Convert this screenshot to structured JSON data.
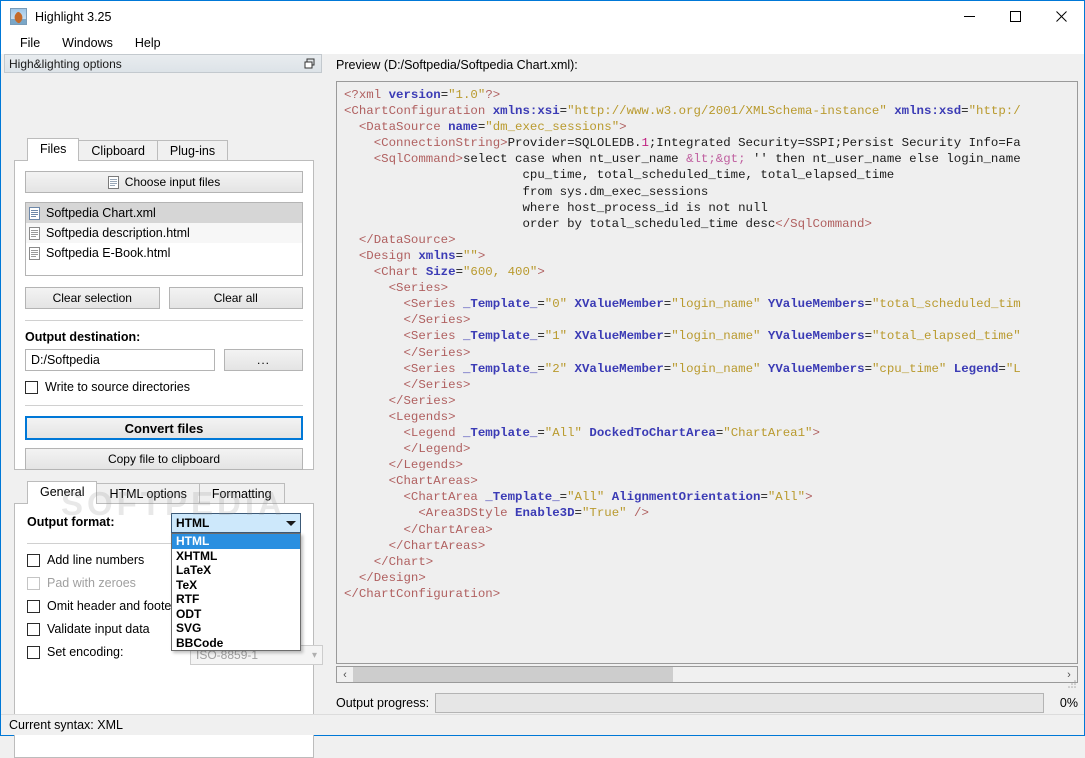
{
  "window": {
    "title": "Highlight 3.25",
    "icon": "app-icon",
    "minimize": "—",
    "maximize": "□",
    "close": "✕"
  },
  "menu": {
    "items": [
      "File",
      "Windows",
      "Help"
    ]
  },
  "dock": {
    "title": "High&lighting options",
    "undock_icon": "undock-icon"
  },
  "files_panel": {
    "tabs": [
      {
        "label": "Files",
        "active": true
      },
      {
        "label": "Clipboard",
        "active": false
      },
      {
        "label": "Plug-ins",
        "active": false
      }
    ],
    "choose_input_files": "Choose input files",
    "file_list": [
      {
        "name": "Softpedia Chart.xml",
        "selected": true
      },
      {
        "name": "Softpedia description.html",
        "selected": false
      },
      {
        "name": "Softpedia E-Book.html",
        "selected": false
      }
    ],
    "clear_selection": "Clear selection",
    "clear_all": "Clear all",
    "output_destination_label": "Output destination:",
    "output_destination_value": "D:/Softpedia",
    "browse_button": "...",
    "write_to_source_label": "Write to source directories",
    "write_to_source_checked": false,
    "convert_files": "Convert files",
    "copy_to_clipboard": "Copy file to clipboard"
  },
  "options_panel": {
    "tabs": [
      {
        "label": "General",
        "active": true
      },
      {
        "label": "HTML options",
        "active": false
      },
      {
        "label": "Formatting",
        "active": false
      }
    ],
    "output_format_label": "Output format:",
    "output_format_value": "HTML",
    "output_format_options": [
      "HTML",
      "XHTML",
      "LaTeX",
      "TeX",
      "RTF",
      "ODT",
      "SVG",
      "BBCode"
    ],
    "output_format_selected_index": 0,
    "checkboxes": [
      {
        "label": "Add line numbers",
        "checked": false,
        "disabled": false
      },
      {
        "label": "Pad with zeroes",
        "checked": false,
        "disabled": true
      },
      {
        "label": "Omit header and footer",
        "checked": false,
        "disabled": false
      },
      {
        "label": "Validate input data",
        "checked": false,
        "disabled": false
      },
      {
        "label": "Set encoding:",
        "checked": false,
        "disabled": false
      }
    ],
    "encoding_value": "ISO-8859-1"
  },
  "watermark": "SOFTPEDIA",
  "preview": {
    "label": "Preview (D:/Softpedia/Softpedia Chart.xml):",
    "hscroll": {
      "left_arrow": "‹",
      "right_arrow": "›"
    }
  },
  "progress": {
    "label": "Output progress:",
    "percent": "0%",
    "value": 0
  },
  "status": {
    "text": "Current syntax: XML"
  },
  "colors": {
    "accent": "#0078d7",
    "tag": "#b06060",
    "attr_name": "#7b7bc0",
    "attr_value": "#b99a2e",
    "element_name": "#3b3bb5",
    "entity": "#c060a0",
    "number": "#c02080",
    "selection": "#2a8fe0"
  },
  "code_lines": [
    [
      {
        "t": "pi",
        "v": "<?xml "
      },
      {
        "t": "name",
        "v": "version"
      },
      {
        "t": "txt",
        "v": "="
      },
      {
        "t": "str",
        "v": "\"1.0\""
      },
      {
        "t": "pi",
        "v": "?>"
      }
    ],
    [
      {
        "t": "tag",
        "v": "<ChartConfiguration "
      },
      {
        "t": "name",
        "v": "xmlns:xsi"
      },
      {
        "t": "txt",
        "v": "="
      },
      {
        "t": "str",
        "v": "\"http://www.w3.org/2001/XMLSchema-instance\""
      },
      {
        "t": "txt",
        "v": " "
      },
      {
        "t": "name",
        "v": "xmlns:xsd"
      },
      {
        "t": "txt",
        "v": "="
      },
      {
        "t": "str",
        "v": "\"http:/"
      }
    ],
    [
      {
        "t": "txt",
        "v": "  "
      },
      {
        "t": "tag",
        "v": "<DataSource "
      },
      {
        "t": "name",
        "v": "name"
      },
      {
        "t": "txt",
        "v": "="
      },
      {
        "t": "str",
        "v": "\"dm_exec_sessions\""
      },
      {
        "t": "tag",
        "v": ">"
      }
    ],
    [
      {
        "t": "txt",
        "v": "    "
      },
      {
        "t": "tag",
        "v": "<ConnectionString>"
      },
      {
        "t": "txt",
        "v": "Provider=SQLOLEDB."
      },
      {
        "t": "num",
        "v": "1"
      },
      {
        "t": "txt",
        "v": ";Integrated Security=SSPI;Persist Security Info=Fa"
      }
    ],
    [
      {
        "t": "txt",
        "v": "    "
      },
      {
        "t": "tag",
        "v": "<SqlCommand>"
      },
      {
        "t": "txt",
        "v": "select case when nt_user_name "
      },
      {
        "t": "ent",
        "v": "&lt;&gt;"
      },
      {
        "t": "txt",
        "v": " '' then nt_user_name else login_name"
      }
    ],
    [
      {
        "t": "txt",
        "v": "                        cpu_time, total_scheduled_time, total_elapsed_time"
      }
    ],
    [
      {
        "t": "txt",
        "v": "                        from sys.dm_exec_sessions"
      }
    ],
    [
      {
        "t": "txt",
        "v": "                        where host_process_id is not null"
      }
    ],
    [
      {
        "t": "txt",
        "v": "                        order by total_scheduled_time desc"
      },
      {
        "t": "tag",
        "v": "</SqlCommand>"
      }
    ],
    [
      {
        "t": "txt",
        "v": "  "
      },
      {
        "t": "tag",
        "v": "</DataSource>"
      }
    ],
    [
      {
        "t": "txt",
        "v": "  "
      },
      {
        "t": "tag",
        "v": "<Design "
      },
      {
        "t": "name",
        "v": "xmlns"
      },
      {
        "t": "txt",
        "v": "="
      },
      {
        "t": "str",
        "v": "\"\""
      },
      {
        "t": "tag",
        "v": ">"
      }
    ],
    [
      {
        "t": "txt",
        "v": "    "
      },
      {
        "t": "tag",
        "v": "<Chart "
      },
      {
        "t": "name",
        "v": "Size"
      },
      {
        "t": "txt",
        "v": "="
      },
      {
        "t": "str",
        "v": "\"600, 400\""
      },
      {
        "t": "tag",
        "v": ">"
      }
    ],
    [
      {
        "t": "txt",
        "v": "      "
      },
      {
        "t": "tag",
        "v": "<Series>"
      }
    ],
    [
      {
        "t": "txt",
        "v": "        "
      },
      {
        "t": "tag",
        "v": "<Series "
      },
      {
        "t": "name",
        "v": "_Template_"
      },
      {
        "t": "txt",
        "v": "="
      },
      {
        "t": "str",
        "v": "\"0\""
      },
      {
        "t": "txt",
        "v": " "
      },
      {
        "t": "name",
        "v": "XValueMember"
      },
      {
        "t": "txt",
        "v": "="
      },
      {
        "t": "str",
        "v": "\"login_name\""
      },
      {
        "t": "txt",
        "v": " "
      },
      {
        "t": "name",
        "v": "YValueMembers"
      },
      {
        "t": "txt",
        "v": "="
      },
      {
        "t": "str",
        "v": "\"total_scheduled_tim"
      }
    ],
    [
      {
        "t": "txt",
        "v": "        "
      },
      {
        "t": "tag",
        "v": "</Series>"
      }
    ],
    [
      {
        "t": "txt",
        "v": "        "
      },
      {
        "t": "tag",
        "v": "<Series "
      },
      {
        "t": "name",
        "v": "_Template_"
      },
      {
        "t": "txt",
        "v": "="
      },
      {
        "t": "str",
        "v": "\"1\""
      },
      {
        "t": "txt",
        "v": " "
      },
      {
        "t": "name",
        "v": "XValueMember"
      },
      {
        "t": "txt",
        "v": "="
      },
      {
        "t": "str",
        "v": "\"login_name\""
      },
      {
        "t": "txt",
        "v": " "
      },
      {
        "t": "name",
        "v": "YValueMembers"
      },
      {
        "t": "txt",
        "v": "="
      },
      {
        "t": "str",
        "v": "\"total_elapsed_time\""
      }
    ],
    [
      {
        "t": "txt",
        "v": "        "
      },
      {
        "t": "tag",
        "v": "</Series>"
      }
    ],
    [
      {
        "t": "txt",
        "v": "        "
      },
      {
        "t": "tag",
        "v": "<Series "
      },
      {
        "t": "name",
        "v": "_Template_"
      },
      {
        "t": "txt",
        "v": "="
      },
      {
        "t": "str",
        "v": "\"2\""
      },
      {
        "t": "txt",
        "v": " "
      },
      {
        "t": "name",
        "v": "XValueMember"
      },
      {
        "t": "txt",
        "v": "="
      },
      {
        "t": "str",
        "v": "\"login_name\""
      },
      {
        "t": "txt",
        "v": " "
      },
      {
        "t": "name",
        "v": "YValueMembers"
      },
      {
        "t": "txt",
        "v": "="
      },
      {
        "t": "str",
        "v": "\"cpu_time\""
      },
      {
        "t": "txt",
        "v": " "
      },
      {
        "t": "name",
        "v": "Legend"
      },
      {
        "t": "txt",
        "v": "="
      },
      {
        "t": "str",
        "v": "\"L"
      }
    ],
    [
      {
        "t": "txt",
        "v": "        "
      },
      {
        "t": "tag",
        "v": "</Series>"
      }
    ],
    [
      {
        "t": "txt",
        "v": "      "
      },
      {
        "t": "tag",
        "v": "</Series>"
      }
    ],
    [
      {
        "t": "txt",
        "v": "      "
      },
      {
        "t": "tag",
        "v": "<Legends>"
      }
    ],
    [
      {
        "t": "txt",
        "v": "        "
      },
      {
        "t": "tag",
        "v": "<Legend "
      },
      {
        "t": "name",
        "v": "_Template_"
      },
      {
        "t": "txt",
        "v": "="
      },
      {
        "t": "str",
        "v": "\"All\""
      },
      {
        "t": "txt",
        "v": " "
      },
      {
        "t": "name",
        "v": "DockedToChartArea"
      },
      {
        "t": "txt",
        "v": "="
      },
      {
        "t": "str",
        "v": "\"ChartArea1\""
      },
      {
        "t": "tag",
        "v": ">"
      }
    ],
    [
      {
        "t": "txt",
        "v": "        "
      },
      {
        "t": "tag",
        "v": "</Legend>"
      }
    ],
    [
      {
        "t": "txt",
        "v": "      "
      },
      {
        "t": "tag",
        "v": "</Legends>"
      }
    ],
    [
      {
        "t": "txt",
        "v": "      "
      },
      {
        "t": "tag",
        "v": "<ChartAreas>"
      }
    ],
    [
      {
        "t": "txt",
        "v": "        "
      },
      {
        "t": "tag",
        "v": "<ChartArea "
      },
      {
        "t": "name",
        "v": "_Template_"
      },
      {
        "t": "txt",
        "v": "="
      },
      {
        "t": "str",
        "v": "\"All\""
      },
      {
        "t": "txt",
        "v": " "
      },
      {
        "t": "name",
        "v": "AlignmentOrientation"
      },
      {
        "t": "txt",
        "v": "="
      },
      {
        "t": "str",
        "v": "\"All\""
      },
      {
        "t": "tag",
        "v": ">"
      }
    ],
    [
      {
        "t": "txt",
        "v": "          "
      },
      {
        "t": "tag",
        "v": "<Area3DStyle "
      },
      {
        "t": "name",
        "v": "Enable3D"
      },
      {
        "t": "txt",
        "v": "="
      },
      {
        "t": "str",
        "v": "\"True\""
      },
      {
        "t": "txt",
        "v": " "
      },
      {
        "t": "tag",
        "v": "/>"
      }
    ],
    [
      {
        "t": "txt",
        "v": "        "
      },
      {
        "t": "tag",
        "v": "</ChartArea>"
      }
    ],
    [
      {
        "t": "txt",
        "v": "      "
      },
      {
        "t": "tag",
        "v": "</ChartAreas>"
      }
    ],
    [
      {
        "t": "txt",
        "v": "    "
      },
      {
        "t": "tag",
        "v": "</Chart>"
      }
    ],
    [
      {
        "t": "txt",
        "v": "  "
      },
      {
        "t": "tag",
        "v": "</Design>"
      }
    ],
    [
      {
        "t": "tag",
        "v": "</ChartConfiguration>"
      }
    ]
  ]
}
